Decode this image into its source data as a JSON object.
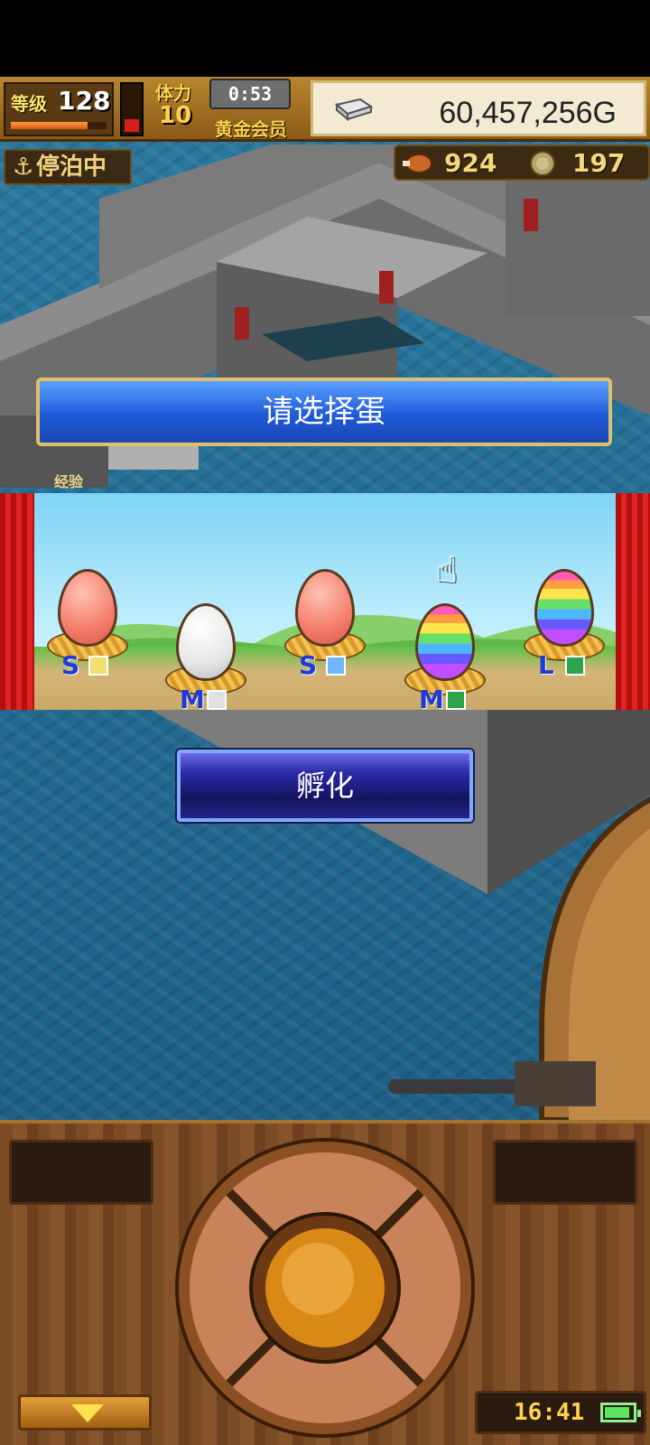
{
  "hud": {
    "level_label": "等级",
    "level_value": "128",
    "level_progress": 0.8,
    "stamina_label": "体力",
    "stamina_value": "10",
    "stamina_gauge": 0.25,
    "timer": "0:53",
    "membership": "黄金会员",
    "gold": "60,457,256G"
  },
  "status": {
    "anchor_text": "停泊中",
    "food_count": "924",
    "coin_count": "197"
  },
  "dialog": {
    "title": "请选择蛋",
    "hatch_label": "孵化"
  },
  "xp_label": "经验",
  "eggs": [
    {
      "color": "pink",
      "size": "S",
      "badge_color": "#f0e070"
    },
    {
      "color": "white",
      "size": "M",
      "badge_color": "#e0e0e0"
    },
    {
      "color": "pink",
      "size": "S",
      "badge_color": "#6fb6ff"
    },
    {
      "color": "rainbow",
      "size": "M",
      "badge_color": "#2ea44a"
    },
    {
      "color": "rainbow",
      "size": "L",
      "badge_color": "#2ea44a"
    }
  ],
  "bottom": {
    "clock": "16:41",
    "battery_level": 0.9
  },
  "icons": [
    "anchor-icon",
    "gold-bar-icon",
    "food-icon",
    "coin-icon",
    "pointer-hand-icon",
    "arrow-down-icon",
    "battery-icon"
  ]
}
